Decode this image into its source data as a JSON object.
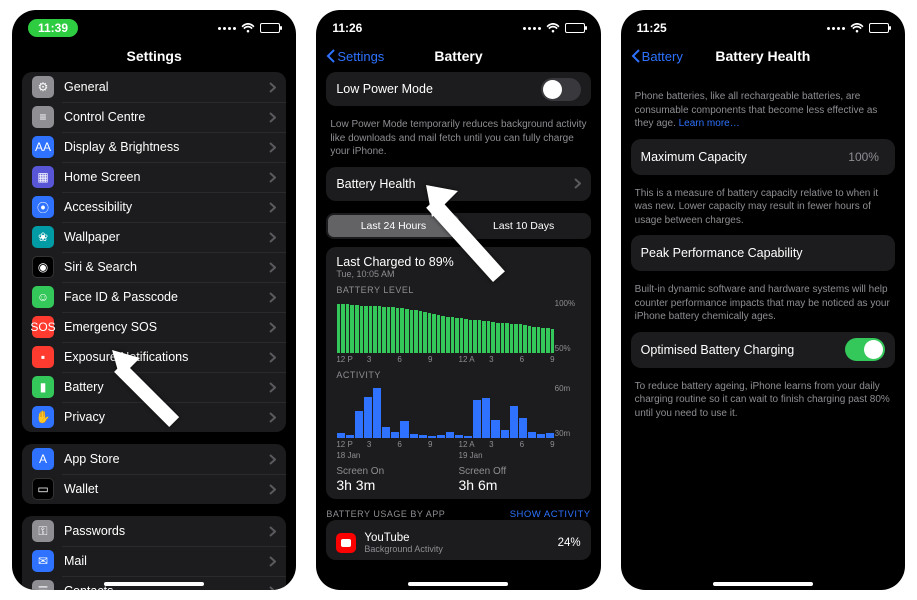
{
  "phones": {
    "settings": {
      "clock": "11:39",
      "title": "Settings",
      "group1": [
        {
          "name": "general",
          "label": "General",
          "icon": "gear",
          "color": "c-gray"
        },
        {
          "name": "control-centre",
          "label": "Control Centre",
          "icon": "sliders",
          "color": "c-gray"
        },
        {
          "name": "display",
          "label": "Display & Brightness",
          "icon": "AA",
          "color": "c-blue"
        },
        {
          "name": "home-screen",
          "label": "Home Screen",
          "icon": "grid",
          "color": "c-purple"
        },
        {
          "name": "accessibility",
          "label": "Accessibility",
          "icon": "person",
          "color": "c-blue"
        },
        {
          "name": "wallpaper",
          "label": "Wallpaper",
          "icon": "flower",
          "color": "c-teal"
        },
        {
          "name": "siri",
          "label": "Siri & Search",
          "icon": "siri",
          "color": "c-black"
        },
        {
          "name": "faceid",
          "label": "Face ID & Passcode",
          "icon": "face",
          "color": "c-green"
        },
        {
          "name": "sos",
          "label": "Emergency SOS",
          "icon": "SOS",
          "color": "c-red"
        },
        {
          "name": "exposure",
          "label": "Exposure Notifications",
          "icon": "virus",
          "color": "c-red"
        },
        {
          "name": "battery",
          "label": "Battery",
          "icon": "battery",
          "color": "c-green"
        },
        {
          "name": "privacy",
          "label": "Privacy",
          "icon": "hand",
          "color": "c-blue"
        }
      ],
      "group2": [
        {
          "name": "appstore",
          "label": "App Store",
          "icon": "A",
          "color": "c-blue"
        },
        {
          "name": "wallet",
          "label": "Wallet",
          "icon": "wallet",
          "color": "c-black"
        }
      ],
      "group3": [
        {
          "name": "passwords",
          "label": "Passwords",
          "icon": "key",
          "color": "c-gray"
        },
        {
          "name": "mail",
          "label": "Mail",
          "icon": "mail",
          "color": "c-blue"
        },
        {
          "name": "contacts",
          "label": "Contacts",
          "icon": "contacts",
          "color": "c-gray"
        }
      ]
    },
    "battery": {
      "clock": "11:26",
      "back": "Settings",
      "title": "Battery",
      "lowpower_label": "Low Power Mode",
      "lowpower_desc": "Low Power Mode temporarily reduces background activity like downloads and mail fetch until you can fully charge your iPhone.",
      "health_label": "Battery Health",
      "seg": {
        "a": "Last 24 Hours",
        "b": "Last 10 Days"
      },
      "last_charged_title": "Last Charged to 89%",
      "last_charged_sub": "Tue, 10:05 AM",
      "level_label": "BATTERY LEVEL",
      "level_ylabels": [
        "100%",
        "50%"
      ],
      "x_ticks": [
        "12 P",
        "3",
        "6",
        "9",
        "12 A",
        "3",
        "6",
        "9"
      ],
      "x_dates": {
        "a": "18 Jan",
        "b": "19 Jan"
      },
      "activity_label": "ACTIVITY",
      "activity_ylabels": [
        "60m",
        "30m"
      ],
      "screen_on_k": "Screen On",
      "screen_on_v": "3h 3m",
      "screen_off_k": "Screen Off",
      "screen_off_v": "3h 6m",
      "usage_hdr": "BATTERY USAGE BY APP",
      "usage_link": "SHOW ACTIVITY",
      "app": {
        "name": "YouTube",
        "sub": "Background Activity",
        "pct": "24%"
      }
    },
    "health": {
      "clock": "11:25",
      "back": "Battery",
      "title": "Battery Health",
      "intro": "Phone batteries, like all rechargeable batteries, are consumable components that become less effective as they age. ",
      "intro_link": "Learn more…",
      "maxcap_label": "Maximum Capacity",
      "maxcap_value": "100%",
      "maxcap_desc": "This is a measure of battery capacity relative to when it was new. Lower capacity may result in fewer hours of usage between charges.",
      "peak_label": "Peak Performance Capability",
      "peak_desc": "Built-in dynamic software and hardware systems will help counter performance impacts that may be noticed as your iPhone battery chemically ages.",
      "opt_label": "Optimised Battery Charging",
      "opt_desc": "To reduce battery ageing, iPhone learns from your daily charging routine so it can wait to finish charging past 80% until you need to use it."
    }
  },
  "chart_data": [
    {
      "type": "bar",
      "title": "BATTERY LEVEL",
      "ylabel": "%",
      "ylim": [
        0,
        100
      ],
      "x_ticks": [
        "12 P",
        "3",
        "6",
        "9",
        "12 A",
        "3",
        "6",
        "9"
      ],
      "values": [
        90,
        89,
        89,
        88,
        88,
        87,
        87,
        86,
        86,
        86,
        85,
        84,
        84,
        83,
        82,
        80,
        79,
        78,
        76,
        75,
        74,
        72,
        70,
        68,
        66,
        65,
        64,
        63,
        62,
        61,
        60,
        60,
        59,
        58,
        57,
        55,
        55,
        54,
        53,
        53,
        52,
        51,
        49,
        48,
        47,
        46,
        45,
        44
      ]
    },
    {
      "type": "bar",
      "title": "ACTIVITY",
      "ylabel": "minutes",
      "ylim": [
        0,
        60
      ],
      "x_ticks": [
        "12 P",
        "3",
        "6",
        "9",
        "12 A",
        "3",
        "6",
        "9"
      ],
      "values": [
        5,
        3,
        30,
        45,
        55,
        12,
        6,
        18,
        4,
        3,
        2,
        3,
        6,
        3,
        2,
        42,
        44,
        20,
        8,
        35,
        22,
        6,
        4,
        5
      ]
    }
  ]
}
